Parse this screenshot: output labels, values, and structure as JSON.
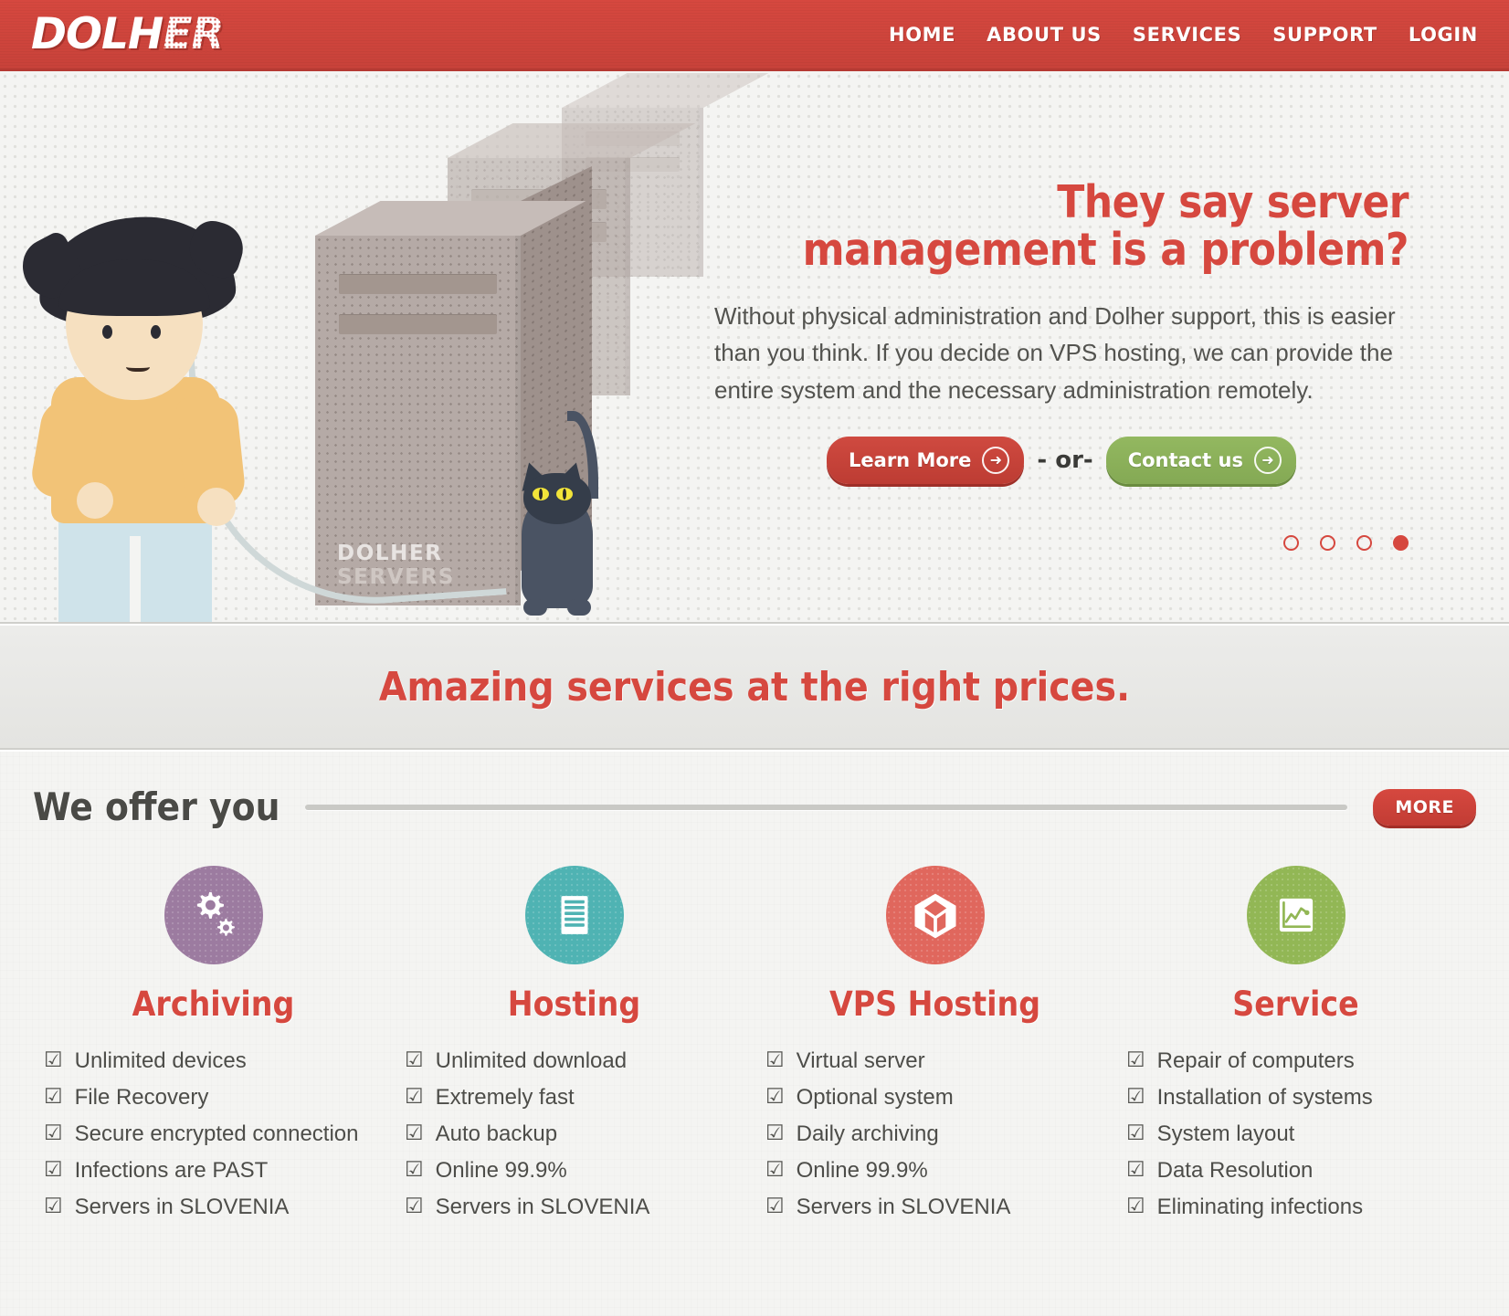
{
  "brand": {
    "logo_prefix": "DOLH",
    "logo_suffix": "ER",
    "accent_red": "#d6483f",
    "accent_green": "#8fb45e"
  },
  "nav": {
    "items": [
      {
        "label": "HOME"
      },
      {
        "label": "ABOUT US"
      },
      {
        "label": "SERVICES"
      },
      {
        "label": "SUPPORT"
      },
      {
        "label": "LOGIN"
      }
    ]
  },
  "hero": {
    "title_line1": "They say server",
    "title_line2": "management is a problem?",
    "body": "Without physical administration and Dolher support, this is easier than you think. If you decide on VPS hosting, we can provide the entire system and the necessary administration remotely.",
    "primary_button": "Learn More",
    "primary_icon": "arrow-right-circle-icon",
    "separator": "- or-",
    "secondary_button": "Contact us",
    "secondary_icon": "arrow-right-circle-icon",
    "server_label_bold": "DOLHER",
    "server_label_light": "SERVERS",
    "carousel": {
      "count": 4,
      "active_index": 3
    }
  },
  "tagline": "Amazing services at the right prices.",
  "offer": {
    "title": "We offer you",
    "more_label": "MORE",
    "cards": [
      {
        "icon": "gears-icon",
        "icon_color": "#9c7ba0",
        "title": "Archiving",
        "features": [
          "Unlimited devices",
          "File Recovery",
          "Secure encrypted connection",
          "Infections are PAST",
          "Servers in SLOVENIA"
        ]
      },
      {
        "icon": "server-rack-icon",
        "icon_color": "#4fb3b3",
        "title": "Hosting",
        "features": [
          "Unlimited download",
          "Extremely fast",
          "Auto backup",
          "Online 99.9%",
          "Servers in SLOVENIA"
        ]
      },
      {
        "icon": "cube-box-icon",
        "icon_color": "#e0675d",
        "title": "VPS Hosting",
        "features": [
          "Virtual server",
          "Optional system",
          "Daily archiving",
          "Online 99.9%",
          "Servers in SLOVENIA"
        ]
      },
      {
        "icon": "line-chart-icon",
        "icon_color": "#92b755",
        "title": "Service",
        "features": [
          "Repair of computers",
          "Installation of systems",
          "System layout",
          "Data Resolution",
          "Eliminating infections"
        ]
      }
    ],
    "checkbox_glyph": "☑"
  }
}
